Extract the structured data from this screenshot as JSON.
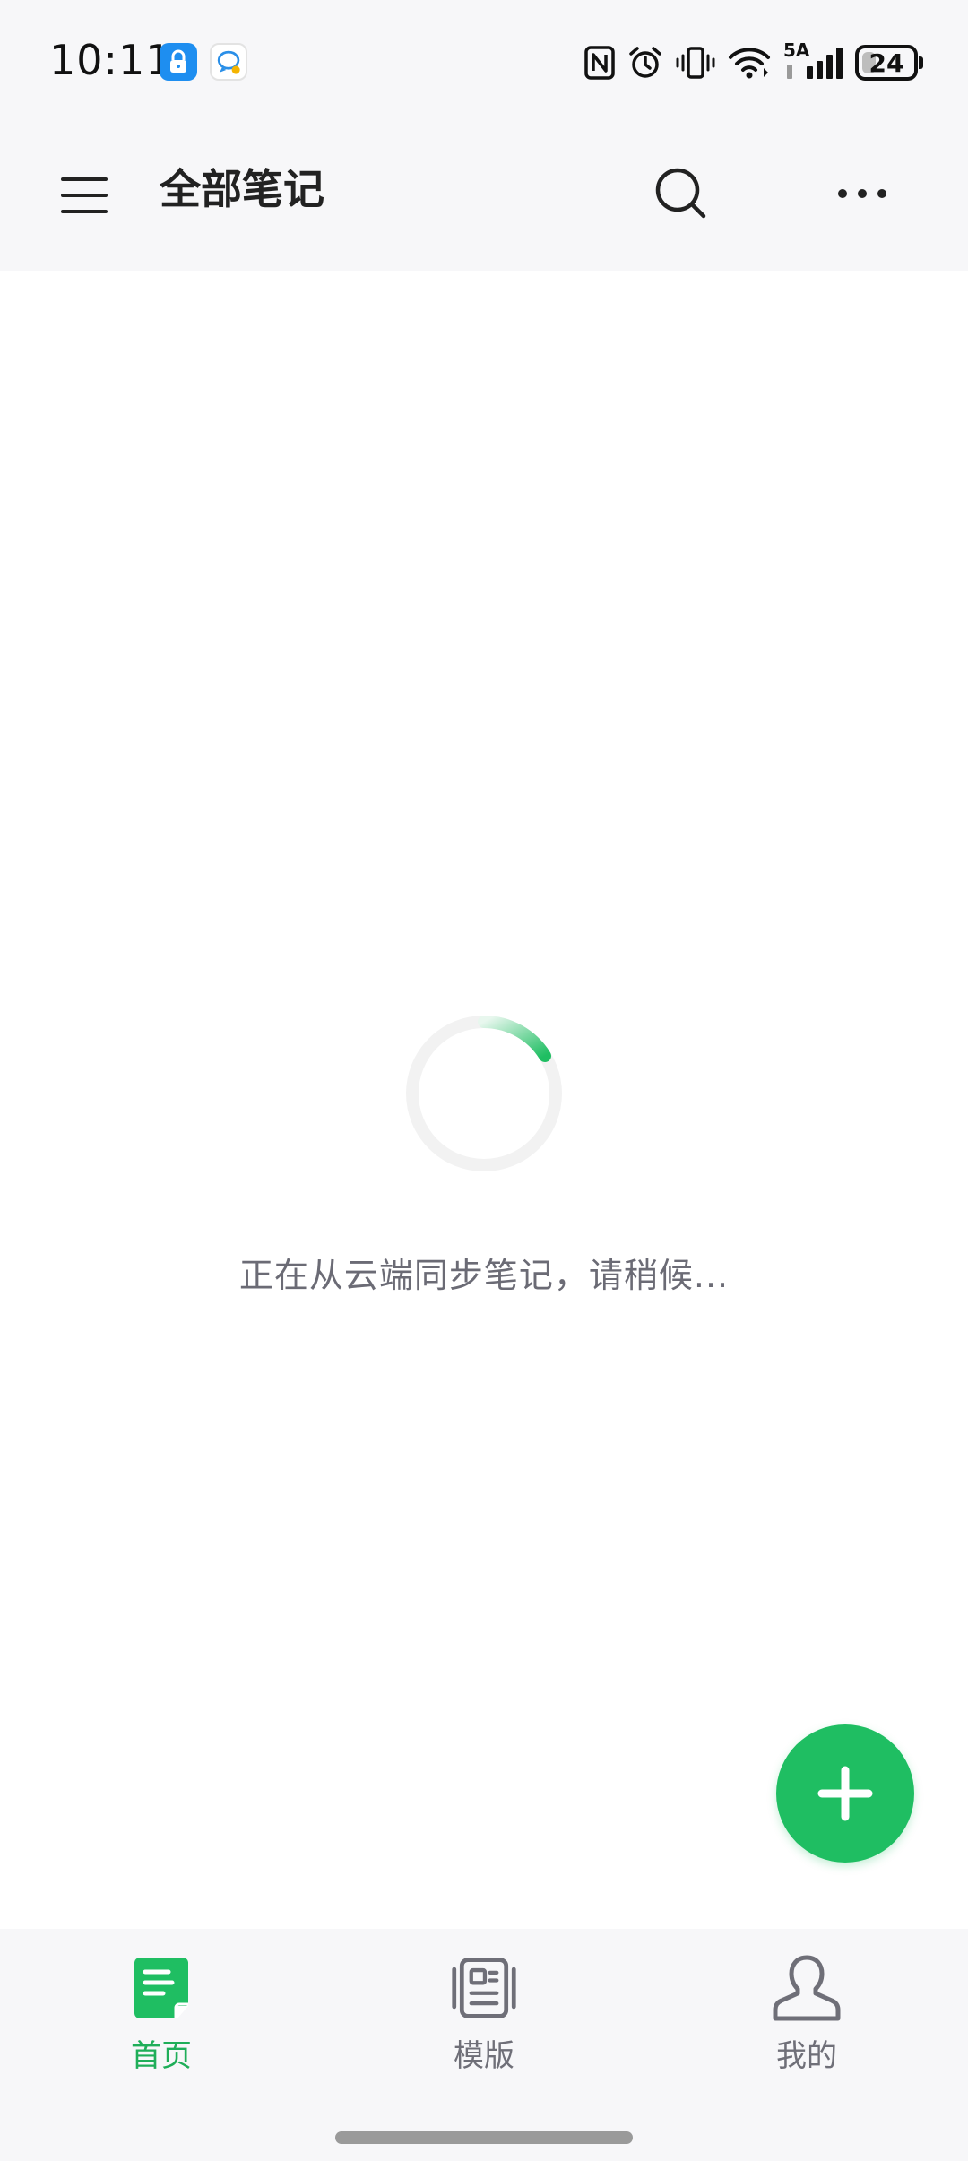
{
  "status_bar": {
    "time": "10:11",
    "network_label": "5A",
    "battery_percent": "24",
    "battery_level": 0.24,
    "icons": [
      "lock-app-icon",
      "chat-app-icon",
      "nfc-icon",
      "alarm-icon",
      "vibrate-icon",
      "wifi-icon",
      "cellular-signal-icon",
      "battery-icon"
    ]
  },
  "app_bar": {
    "title": "全部笔记",
    "menu_icon": "hamburger-menu-icon",
    "search_icon": "search-icon",
    "more_icon": "more-dots-icon"
  },
  "content": {
    "loading_text": "正在从云端同步笔记，请稍候..."
  },
  "fab": {
    "icon": "plus-icon"
  },
  "bottom_nav": {
    "items": [
      {
        "label": "首页",
        "icon": "note-icon",
        "active": true
      },
      {
        "label": "模版",
        "icon": "template-icon",
        "active": false
      },
      {
        "label": "我的",
        "icon": "profile-icon",
        "active": false
      }
    ]
  },
  "colors": {
    "accent": "#1FBE62",
    "accent_text": "#1FAE59",
    "bar_background": "#F7F7F9",
    "text_primary": "#222222",
    "text_secondary": "#6B6B75",
    "nav_inactive": "#6F6F78"
  }
}
